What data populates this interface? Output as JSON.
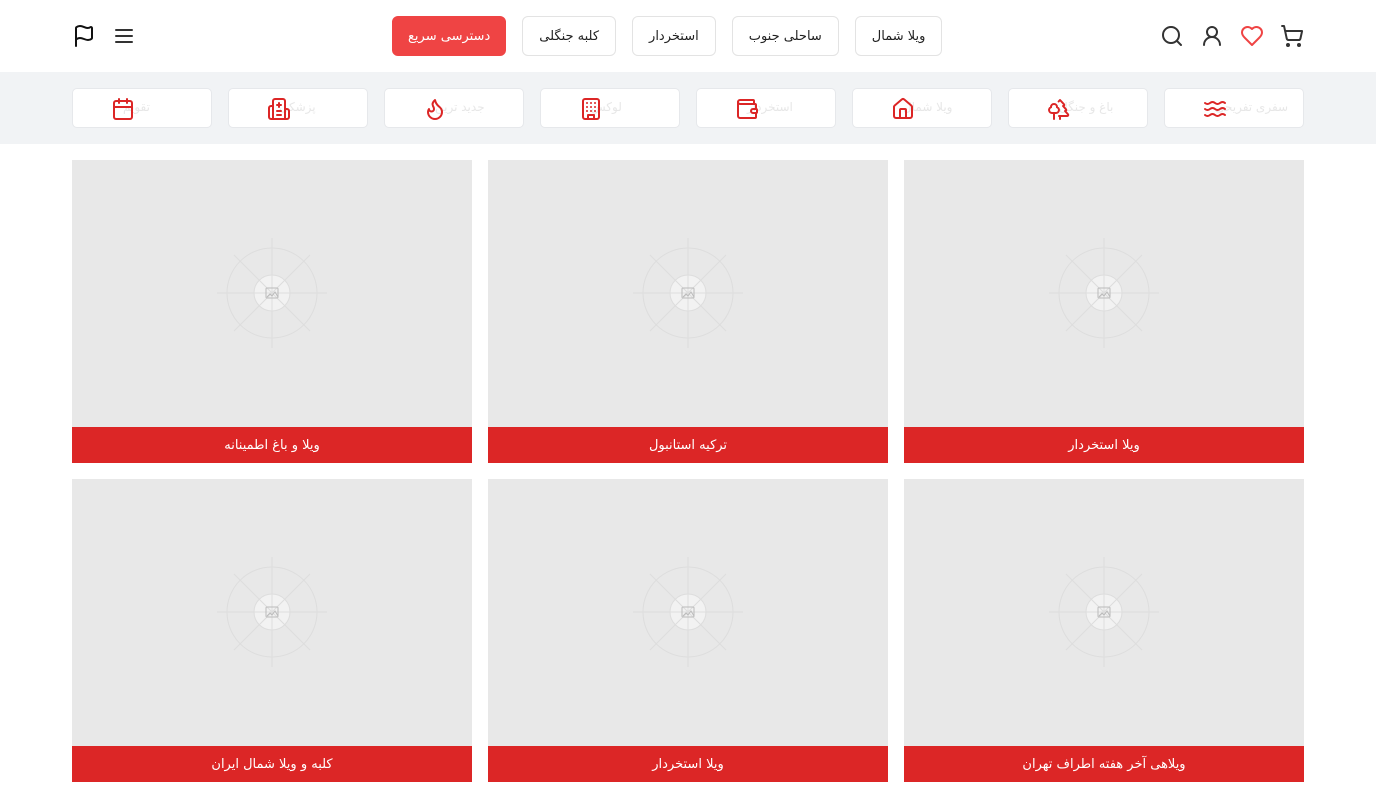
{
  "header": {
    "nav": [
      {
        "label": "ویلا شمال"
      },
      {
        "label": "ساحلی جنوب"
      },
      {
        "label": "استخردار"
      },
      {
        "label": "کلبه جنگلی"
      },
      {
        "label": "دسترسی سریع",
        "primary": true
      }
    ],
    "icons_right": [
      "cart-icon",
      "heart-icon",
      "user-icon",
      "search-icon"
    ],
    "icons_left": [
      "flag-icon",
      "menu-icon"
    ]
  },
  "categories": [
    {
      "label": "سفری تفریحی",
      "icon": "waves-icon"
    },
    {
      "label": "باغ و جنگل",
      "icon": "trees-icon"
    },
    {
      "label": "ویلا شمال",
      "icon": "home-icon"
    },
    {
      "label": "استخردار",
      "icon": "wallet-icon"
    },
    {
      "label": "لوکس",
      "icon": "building-icon"
    },
    {
      "label": "جدید ترین",
      "icon": "flame-icon"
    },
    {
      "label": "پزشکی",
      "icon": "hospital-icon"
    },
    {
      "label": "تقویم",
      "icon": "calendar-icon"
    }
  ],
  "cards": [
    {
      "title": "ویلا استخردار"
    },
    {
      "title": "ترکیه استانبول"
    },
    {
      "title": "ویلا و باغ اطمینانه"
    },
    {
      "title": "ویلاهی آخر هفته اطراف تهران"
    },
    {
      "title": "ویلا استخردار"
    },
    {
      "title": "کلبه و ویلا شمال ایران"
    }
  ],
  "colors": {
    "accent": "#dc2626",
    "primary_button": "#ef4444",
    "strip_bg": "#f1f3f5",
    "placeholder_bg": "#e8e8e8"
  }
}
